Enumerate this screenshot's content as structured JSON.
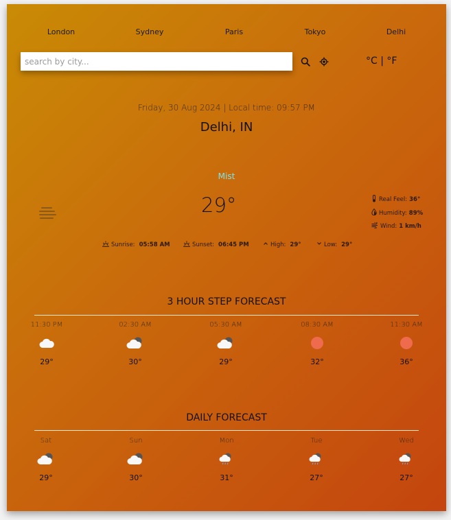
{
  "nav": {
    "cities": [
      "London",
      "Sydney",
      "Paris",
      "Tokyo",
      "Delhi"
    ]
  },
  "search": {
    "placeholder": "search by city...",
    "value": ""
  },
  "units": {
    "celsius": "°C",
    "separator": " | ",
    "fahrenheit": "°F"
  },
  "current": {
    "datetime": "Friday, 30 Aug 2024 | Local time: 09:57 PM",
    "location": "Delhi, IN",
    "condition": "Mist",
    "temperature": "29°",
    "details": {
      "real_feel_label": "Real Feel:",
      "real_feel_value": "36°",
      "humidity_label": "Humidity:",
      "humidity_value": "89%",
      "wind_label": "Wind:",
      "wind_value": "1 km/h"
    },
    "stats": {
      "sunrise_label": "Sunrise:",
      "sunrise_value": "05:58 AM",
      "sunset_label": "Sunset:",
      "sunset_value": "06:45 PM",
      "high_label": "High:",
      "high_value": "29°",
      "low_label": "Low:",
      "low_value": "29°"
    }
  },
  "hourly": {
    "title": "3 HOUR STEP FORECAST",
    "items": [
      {
        "title": "11:30 PM",
        "temp": "29°",
        "icon": "cloud-icon"
      },
      {
        "title": "02:30 AM",
        "temp": "30°",
        "icon": "partly-cloudy-night-icon"
      },
      {
        "title": "05:30 AM",
        "temp": "29°",
        "icon": "partly-cloudy-night-icon"
      },
      {
        "title": "08:30 AM",
        "temp": "32°",
        "icon": "sun-icon"
      },
      {
        "title": "11:30 AM",
        "temp": "36°",
        "icon": "sun-icon"
      }
    ]
  },
  "daily": {
    "title": "DAILY FORECAST",
    "items": [
      {
        "title": "Sat",
        "temp": "29°",
        "icon": "partly-cloudy-night-icon"
      },
      {
        "title": "Sun",
        "temp": "30°",
        "icon": "partly-cloudy-night-icon"
      },
      {
        "title": "Mon",
        "temp": "31°",
        "icon": "rain-cloud-icon"
      },
      {
        "title": "Tue",
        "temp": "27°",
        "icon": "rain-cloud-icon"
      },
      {
        "title": "Wed",
        "temp": "27°",
        "icon": "rain-cloud-icon"
      }
    ]
  },
  "colors": {
    "gradient_start": "#c98b05",
    "gradient_end": "#c4450e",
    "condition": "#7fe3e6",
    "sun": "#ef6b4e"
  }
}
